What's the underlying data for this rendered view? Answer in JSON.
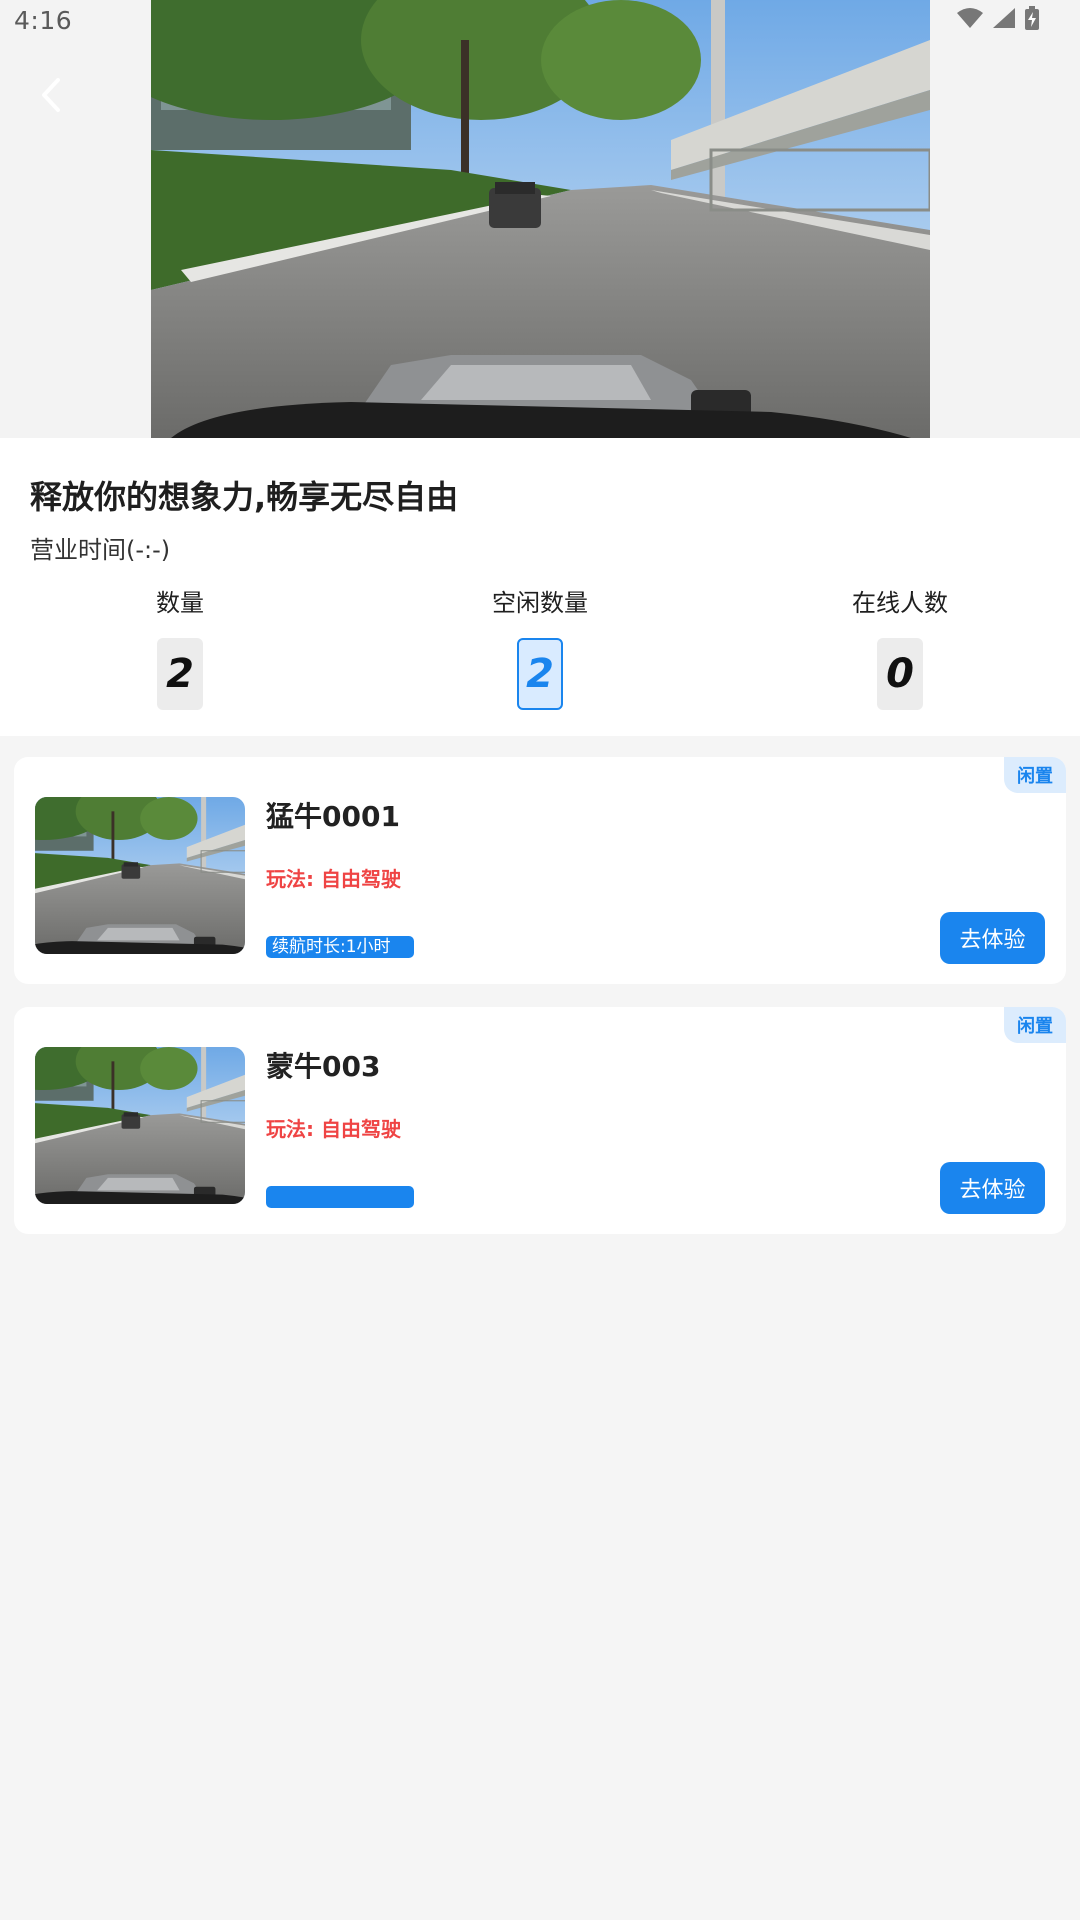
{
  "status_bar": {
    "time": "4:16",
    "icons": [
      "wifi-icon",
      "cellular-signal-icon",
      "battery-charging-icon"
    ]
  },
  "header": {
    "back_icon": "chevron-left-icon",
    "hero_image": "street-rc-car-photo"
  },
  "info": {
    "slogan": "释放你的想象力,畅享无尽自由",
    "hours": "营业时间(-:-)",
    "stats": [
      {
        "label": "数量",
        "value": "2"
      },
      {
        "label": "空闲数量",
        "value": "2"
      },
      {
        "label": "在线人数",
        "value": "0"
      }
    ]
  },
  "vehicles": [
    {
      "name": "猛牛0001",
      "mode": "玩法: 自由驾驶",
      "range": "续航时长:1小时",
      "status": "闲置",
      "button": "去体验"
    },
    {
      "name": "蒙牛003",
      "mode": "玩法: 自由驾驶",
      "range": "",
      "status": "闲置",
      "button": "去体验"
    }
  ],
  "colors": {
    "accent": "#1a85ee",
    "mode_text": "#ef4444",
    "background": "#f5f5f5",
    "badge_bg": "#dcecfd"
  }
}
